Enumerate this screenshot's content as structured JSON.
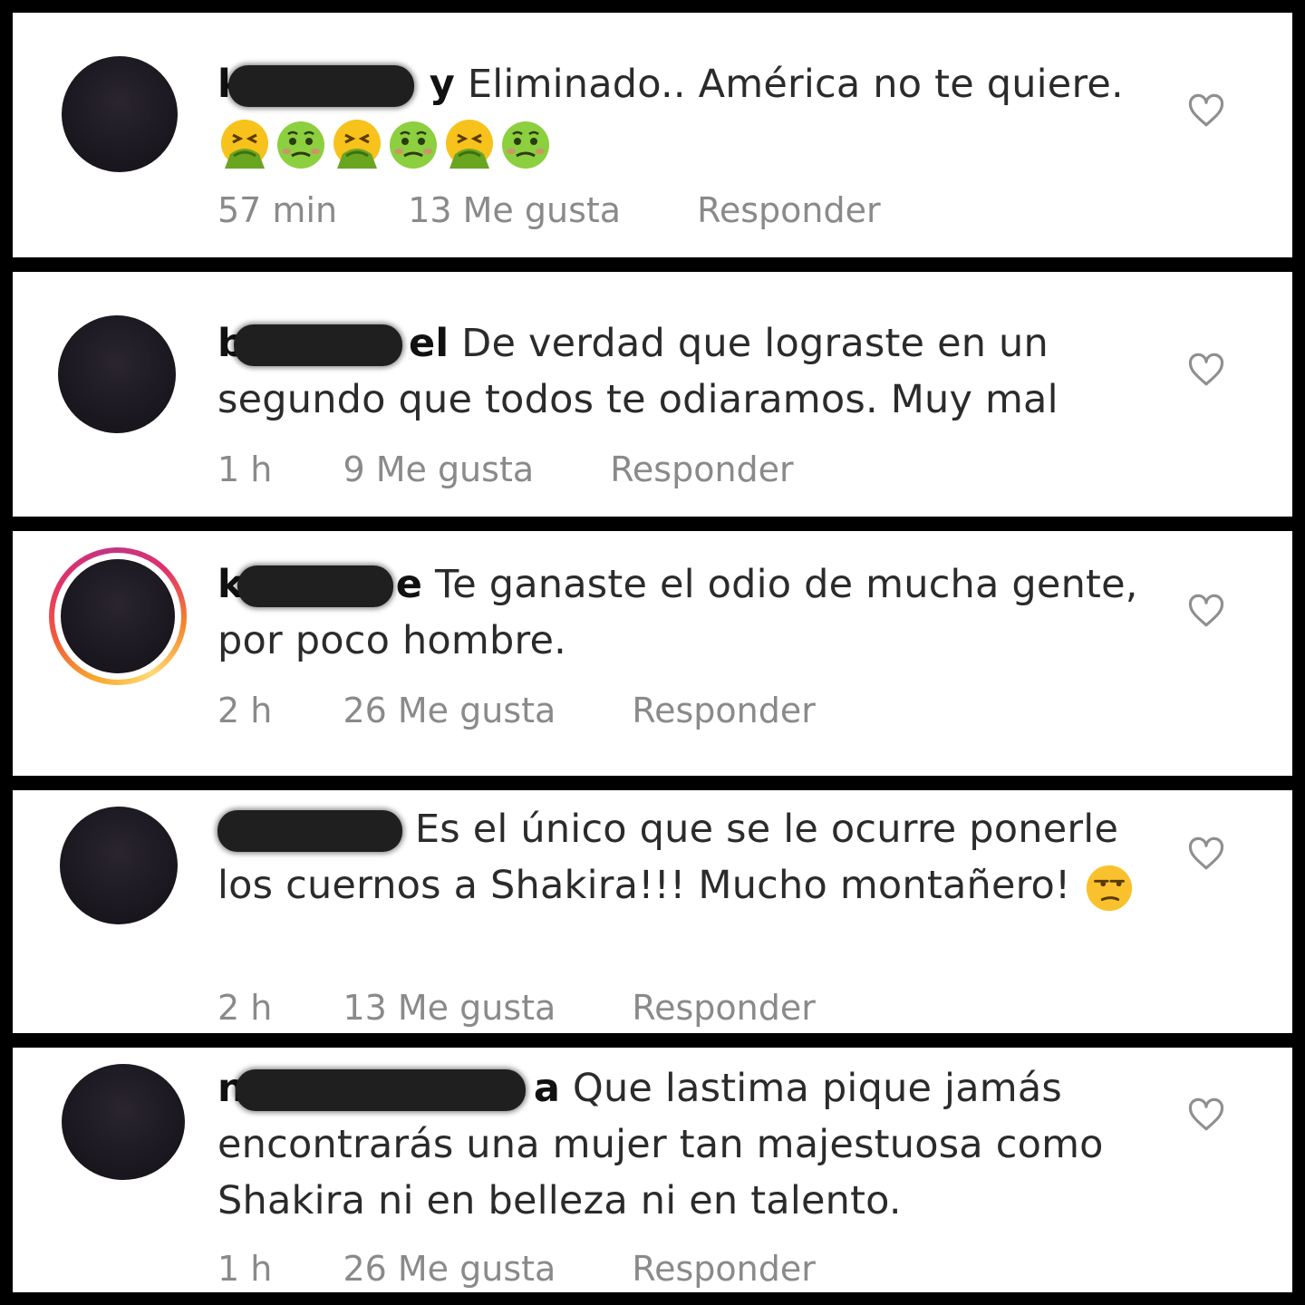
{
  "comments": [
    {
      "username_visible_start": "k",
      "username_visible_end": "y",
      "text": "Eliminado.. América no te quiere.",
      "emoji_row": [
        "tired-face-vomiting",
        "nauseated-face",
        "tired-face-vomiting",
        "nauseated-face",
        "tired-face-vomiting",
        "nauseated-face"
      ],
      "time": "57 min",
      "likes": "13 Me gusta",
      "reply": "Responder"
    },
    {
      "username_visible_start": "b",
      "username_visible_end": "el",
      "text": "De verdad que lograste en un segundo que todos te odiaramos. Muy mal",
      "time": "1 h",
      "likes": "9 Me gusta",
      "reply": "Responder"
    },
    {
      "username_visible_start": "k",
      "username_visible_end": "e",
      "text": "Te ganaste el odio de mucha gente, por poco hombre.",
      "time": "2 h",
      "likes": "26 Me gusta",
      "reply": "Responder"
    },
    {
      "username_visible_start": "",
      "username_visible_end": "",
      "text": "Es el único que se le ocurre ponerle los cuernos a Shakira!!! Mucho montañero!",
      "trailing_emoji": "unamused-face",
      "time": "2 h",
      "likes": "13 Me gusta",
      "reply": "Responder"
    },
    {
      "username_visible_start": "n",
      "username_visible_end": "a",
      "text": "Que lastima pique jamás encontrarás una mujer tan majestuosa como Shakira ni en belleza ni en talento.",
      "time": "1 h",
      "likes": "26 Me gusta",
      "reply": "Responder"
    }
  ],
  "icons": {
    "like": "heart-outline-icon"
  },
  "colors": {
    "text": "#2b2b2b",
    "meta": "#8a8a8a",
    "story_ring": "#e1306c"
  }
}
